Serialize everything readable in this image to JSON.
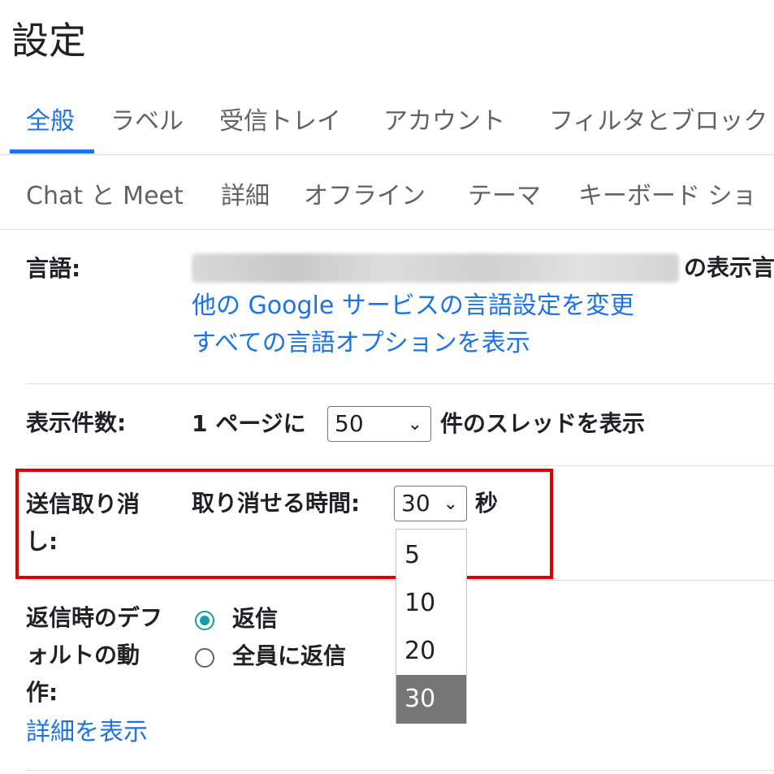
{
  "header": {
    "title": "設定"
  },
  "tabs_row1": [
    {
      "label": "全般",
      "active": true
    },
    {
      "label": "ラベル"
    },
    {
      "label": "受信トレイ"
    },
    {
      "label": "アカウント"
    },
    {
      "label": "フィルタとブロック"
    }
  ],
  "tabs_row2": [
    {
      "label": "Chat と Meet"
    },
    {
      "label": "詳細"
    },
    {
      "label": "オフライン"
    },
    {
      "label": "テーマ"
    },
    {
      "label": "キーボード ショ"
    }
  ],
  "language": {
    "label": "言語:",
    "suffix": "の表示言",
    "link_google": "他の Google サービスの言語設定を変更",
    "link_all": "すべての言語オプションを表示"
  },
  "page_size": {
    "label": "表示件数:",
    "prefix": "1 ページに",
    "value": "50",
    "suffix": "件のスレッドを表示"
  },
  "undo_send": {
    "label_line1": "送信取り消",
    "label_line2": "し:",
    "text": "取り消せる時間:",
    "value": "30",
    "unit": "秒",
    "options": [
      "5",
      "10",
      "20",
      "30"
    ],
    "selected": "30"
  },
  "reply_default": {
    "label_line1": "返信時のデフ",
    "label_line2": "ォルトの動",
    "label_line3": "作:",
    "option_reply": "返信",
    "option_reply_all": "全員に返信",
    "selected": "返信",
    "link_details": "詳細を表示"
  },
  "icons": {
    "chevron": "chevron-down-icon",
    "radio": "radio-icon"
  },
  "colors": {
    "accent": "#1a73e8",
    "radio": "#129eaf",
    "highlight": "#e00000",
    "selected_option": "#767676"
  }
}
